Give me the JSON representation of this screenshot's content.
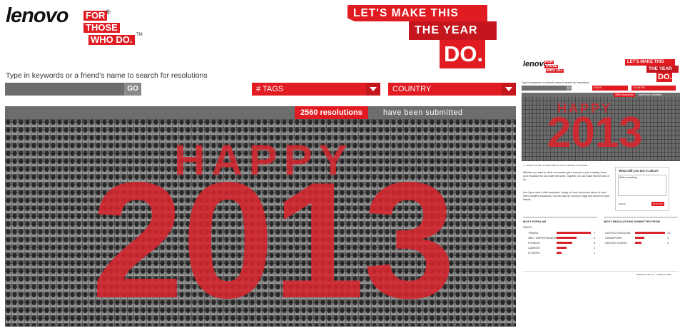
{
  "brand": {
    "logo": "lenovo",
    "registered": "®",
    "tagline": [
      "FOR",
      "THOSE",
      "WHO DO."
    ],
    "trademark": "TM"
  },
  "campaign": {
    "line1": "LET'S MAKE THIS",
    "line2": "THE YEAR OF",
    "line3": "DO."
  },
  "search": {
    "label": "Type in keywords or a friend's name to search for resolutions",
    "placeholder": "",
    "go_label": "GO"
  },
  "filters": {
    "tags_label": "# TAGS",
    "country_label": "COUNTRY"
  },
  "counter": {
    "count": "2560 resolutions",
    "suffix": "have been submitted"
  },
  "hero": {
    "happy": "HAPPY",
    "year": "2013"
  },
  "preview": {
    "logo": "lenovo",
    "tagline": [
      "FOR",
      "THOSE",
      "WHO DO."
    ],
    "campaign": [
      "LET'S MAKE THIS",
      "THE YEAR OF",
      "DO."
    ],
    "search_label": "Type in keywords or a friend's name to search for resolutions",
    "go_label": "GO",
    "tags_label": "#TAGS",
    "country_label": "COUNTRY",
    "count": "2560 resolutions",
    "count_suffix": "have been submitted",
    "happy": "HAPPY",
    "year": "2013",
    "scroll_hint": ">> SCROLL DOWN TO EXPLORE. CLICK AN IMAGE TO EXPAND.",
    "intro_1": "Whether you want to climb a mountain, get a new job or join a charity, share your resolution for 2013 with the world. Together, we can make this the year of do.",
    "intro_2": "And if you need a little inspiration, simply roll over the photos above to read other people's resolutions. You can also fly country or tags and search for your friends.",
    "form_title": "What will you DO in 2013?",
    "form_placeholder": "Write something",
    "form_tag": "#TAGS",
    "form_post": "POST ON",
    "most_popular_title": "MOST POPULAR",
    "tags_heading": "#TAGS",
    "popular": [
      {
        "label": "TRAVEL",
        "value": 7
      },
      {
        "label": "SELF IMPROVEMENT",
        "value": 4
      },
      {
        "label": "FITNESS",
        "value": 3
      },
      {
        "label": "CAREER",
        "value": 2
      },
      {
        "label": "OTHERS",
        "value": 1
      }
    ],
    "countries_title": "MOST RESOLUTIONS SUBMITTED FROM",
    "countries": [
      {
        "label": "UNITED KINGDOM",
        "value": 10
      },
      {
        "label": "SINGAPORE",
        "value": 3
      },
      {
        "label": "UNITED STATES",
        "value": 2
      }
    ],
    "footer_privacy": "PRIVACY POLICY",
    "footer_site": "LENOVO.COM"
  }
}
